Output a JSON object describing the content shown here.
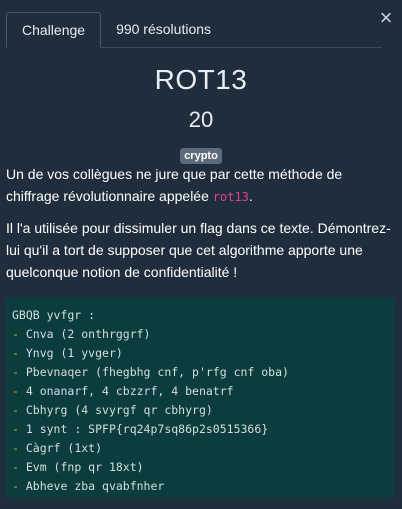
{
  "tabs": [
    {
      "label": "Challenge",
      "active": true
    },
    {
      "label": "990 résolutions",
      "active": false
    }
  ],
  "close_label": "×",
  "challenge": {
    "title": "ROT13",
    "points": "20",
    "tag": "crypto",
    "description": {
      "p1_before": "Un de vos collègues ne jure que par cette méthode de chiffrage révolutionnaire appelée ",
      "p1_code": "rot13",
      "p1_after": ".",
      "p2": "Il l'a utilisée pour dissimuler un flag dans ce texte. Démontrez-lui qu'il a tort de supposer que cet algorithme apporte une quelconque notion de confidentialité !"
    },
    "code_lines": [
      {
        "dash": "",
        "text": "GBQB yvfgr :"
      },
      {
        "dash": "- ",
        "text": "Cnva (2 onthrggrf)"
      },
      {
        "dash": "- ",
        "text": "Ynvg (1 yvger)"
      },
      {
        "dash": "- ",
        "text": "Pbevnaqer (fhegbhg cnf, p'rfg cnf oba)"
      },
      {
        "dash": "- ",
        "text": "4 onanarf, 4 cbzzrf, 4 benatrf"
      },
      {
        "dash": "- ",
        "text": "Cbhyrg (4 svyrgf qr cbhyrg)"
      },
      {
        "dash": "- ",
        "text": "1 synt : SPFP{rq24p7sq86p2s0515366}"
      },
      {
        "dash": "- ",
        "text": "Càgrf (1xt)"
      },
      {
        "dash": "- ",
        "text": "Evm (fnp qr 18xt)"
      },
      {
        "dash": "- ",
        "text": "Abheve zba qvabfnher"
      }
    ]
  },
  "colors": {
    "background": "#1f2d3d",
    "code_background": "#0b3d3d",
    "inline_code": "#e83e8c",
    "tag_background": "#5c6b7b"
  }
}
